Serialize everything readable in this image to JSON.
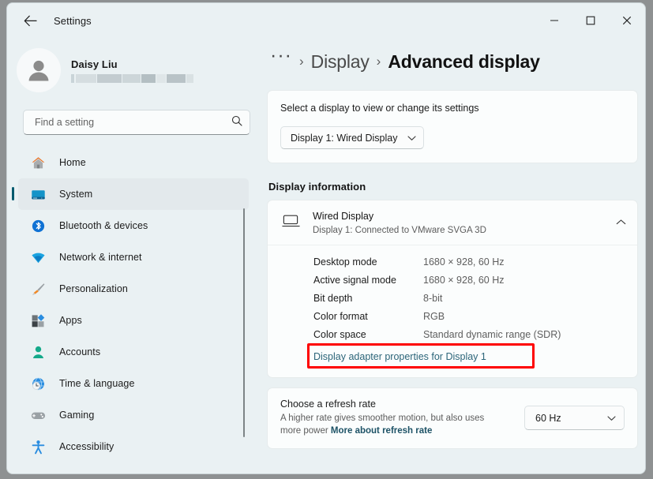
{
  "window": {
    "title": "Settings",
    "back_icon": "back-arrow-icon",
    "minimize_label": "—",
    "maximize_label": "□",
    "close_label": "✕"
  },
  "account": {
    "name": "Daisy Liu",
    "email_redacted": true
  },
  "search": {
    "placeholder": "Find a setting",
    "value": "",
    "icon": "search-icon"
  },
  "sidebar": {
    "items": [
      {
        "label": "Home",
        "icon": "home-icon",
        "selected": false
      },
      {
        "label": "System",
        "icon": "system-monitor-icon",
        "selected": true
      },
      {
        "label": "Bluetooth & devices",
        "icon": "bluetooth-icon",
        "selected": false
      },
      {
        "label": "Network & internet",
        "icon": "wifi-icon",
        "selected": false
      },
      {
        "label": "Personalization",
        "icon": "paintbrush-icon",
        "selected": false
      },
      {
        "label": "Apps",
        "icon": "apps-icon",
        "selected": false
      },
      {
        "label": "Accounts",
        "icon": "person-icon",
        "selected": false
      },
      {
        "label": "Time & language",
        "icon": "clock-globe-icon",
        "selected": false
      },
      {
        "label": "Gaming",
        "icon": "gamepad-icon",
        "selected": false
      },
      {
        "label": "Accessibility",
        "icon": "accessibility-icon",
        "selected": false
      }
    ]
  },
  "breadcrumb": {
    "overflow": "···",
    "separator": "›",
    "parent": "Display",
    "current": "Advanced display"
  },
  "display_picker": {
    "label": "Select a display to view or change its settings",
    "selected": "Display 1: Wired Display",
    "chevron": "chevron-down-icon"
  },
  "display_information": {
    "section_title": "Display information",
    "device_name": "Wired Display",
    "device_sub": "Display 1: Connected to VMware SVGA 3D",
    "device_icon": "monitor-icon",
    "expand_chevron": "chevron-up-icon",
    "rows": [
      {
        "key": "Desktop mode",
        "value": "1680 × 928, 60 Hz"
      },
      {
        "key": "Active signal mode",
        "value": "1680 × 928, 60 Hz"
      },
      {
        "key": "Bit depth",
        "value": "8-bit"
      },
      {
        "key": "Color format",
        "value": "RGB"
      },
      {
        "key": "Color space",
        "value": "Standard dynamic range (SDR)"
      }
    ],
    "adapter_link": "Display adapter properties for Display 1",
    "highlight_color": "#fe0000"
  },
  "refresh_rate": {
    "title": "Choose a refresh rate",
    "desc_part1": "A higher rate gives smoother motion, but also uses more power ",
    "desc_link": "More about refresh rate",
    "selected": "60 Hz",
    "chevron": "chevron-down-icon"
  },
  "colors": {
    "window_bg": "#eaf1f3",
    "card_bg": "#fbfdfd",
    "selected_nav": "#e3e9ec",
    "accent": "#005a6e",
    "link": "#2c6579",
    "highlight": "#fe0000"
  }
}
